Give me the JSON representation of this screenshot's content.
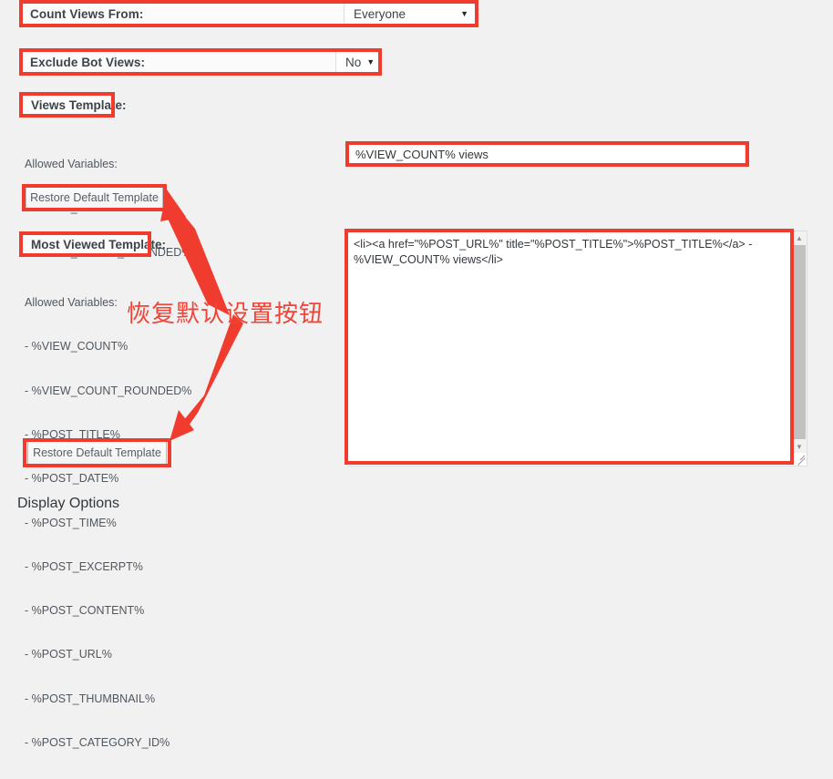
{
  "page": {
    "background": "#f1f1f1",
    "annotation_color": "#f03c2e"
  },
  "settings": {
    "count_views_from": {
      "label": "Count Views From:",
      "value": "Everyone",
      "caret": "chevron-down-icon"
    },
    "exclude_bot_views": {
      "label": "Exclude Bot Views:",
      "value": "No",
      "caret": "chevron-down-icon"
    }
  },
  "views_template": {
    "heading": "Views Template:",
    "allowed_variables_title": "Allowed Variables:",
    "allowed_variables": [
      "- %VIEW_COUNT%",
      "- %VIEW_COUNT_ROUNDED%"
    ],
    "restore_button": "Restore Default Template",
    "input_value": "%VIEW_COUNT% views"
  },
  "most_viewed_template": {
    "heading": "Most Viewed Template:",
    "allowed_variables_title": "Allowed Variables:",
    "allowed_variables": [
      "- %VIEW_COUNT%",
      "- %VIEW_COUNT_ROUNDED%",
      "- %POST_TITLE%",
      "- %POST_DATE%",
      "- %POST_TIME%",
      "- %POST_EXCERPT%",
      "- %POST_CONTENT%",
      "- %POST_URL%",
      "- %POST_THUMBNAIL%",
      "- %POST_CATEGORY_ID%"
    ],
    "restore_button": "Restore Default Template",
    "textarea_value": "<li><a href=\"%POST_URL%\" title=\"%POST_TITLE%\">%POST_TITLE%</a> - %VIEW_COUNT% views</li>",
    "scrollbar": {
      "up_arrow": "scroll-up-arrow-icon",
      "down_arrow": "scroll-down-arrow-icon",
      "resize_handle": "resize-grip-icon"
    }
  },
  "display_options": {
    "heading": "Display Options"
  },
  "annotation": {
    "note_text": "恢复默认设置按钮",
    "arrows": [
      {
        "name": "arrow-to-top-restore-button"
      },
      {
        "name": "arrow-to-bottom-restore-button"
      }
    ]
  }
}
